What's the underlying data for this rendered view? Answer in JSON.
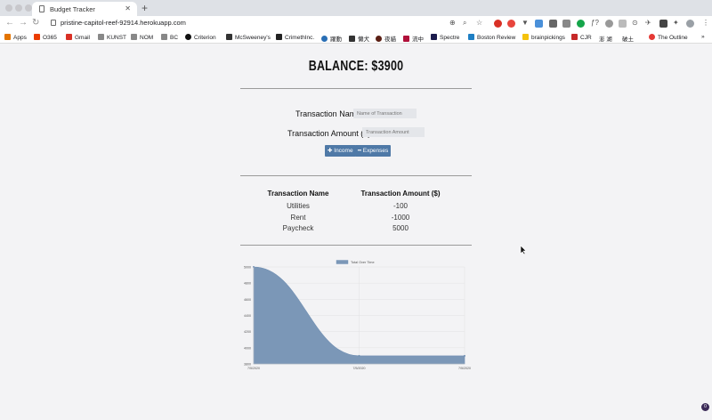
{
  "browser": {
    "tab_title": "Budget Tracker",
    "url": "pristine-capitol-reef-92914.herokuapp.com",
    "bookmarks": [
      "Apps",
      "O365",
      "Gmail",
      "KUNST",
      "NOM",
      "BC",
      "Criterion",
      "McSweeney's",
      "CrimethInc.",
      "躍動",
      "懶犬",
      "夜貓",
      "流中",
      "Spectre",
      "Boston Review",
      "brainpickings",
      "CJR",
      "澎 湖",
      "破土",
      "The Outline"
    ],
    "colors": {
      "tab_strip": "#dee1e6",
      "accent": "#4f79a7"
    }
  },
  "page": {
    "balance": "Balance: $3900",
    "form": {
      "name_label": "Transaction Name",
      "name_placeholder": "Name of Transaction",
      "amount_label": "Transaction Amount ($)",
      "amount_placeholder": "Transaction Amount",
      "income_button": "Income",
      "expense_button": "Expenses"
    },
    "table": {
      "headers": [
        "Transaction Name",
        "Transaction Amount ($)"
      ],
      "rows": [
        [
          "Utilities",
          "-100"
        ],
        [
          "Rent",
          "-1000"
        ],
        [
          "Paycheck",
          "5000"
        ]
      ]
    }
  },
  "chart_data": {
    "type": "area",
    "legend": "Total Over Time",
    "legend_placement": "top",
    "x": [
      "7/5/2020",
      "7/5/2020",
      "7/5/2020"
    ],
    "y": [
      5000,
      3900,
      3900
    ],
    "y_ticks": [
      3800,
      4000,
      4200,
      4400,
      4600,
      4800,
      5000
    ],
    "ylim": [
      3800,
      5000
    ],
    "grid": true,
    "fill_color": "#7b97b7"
  },
  "notification_badge": "0"
}
